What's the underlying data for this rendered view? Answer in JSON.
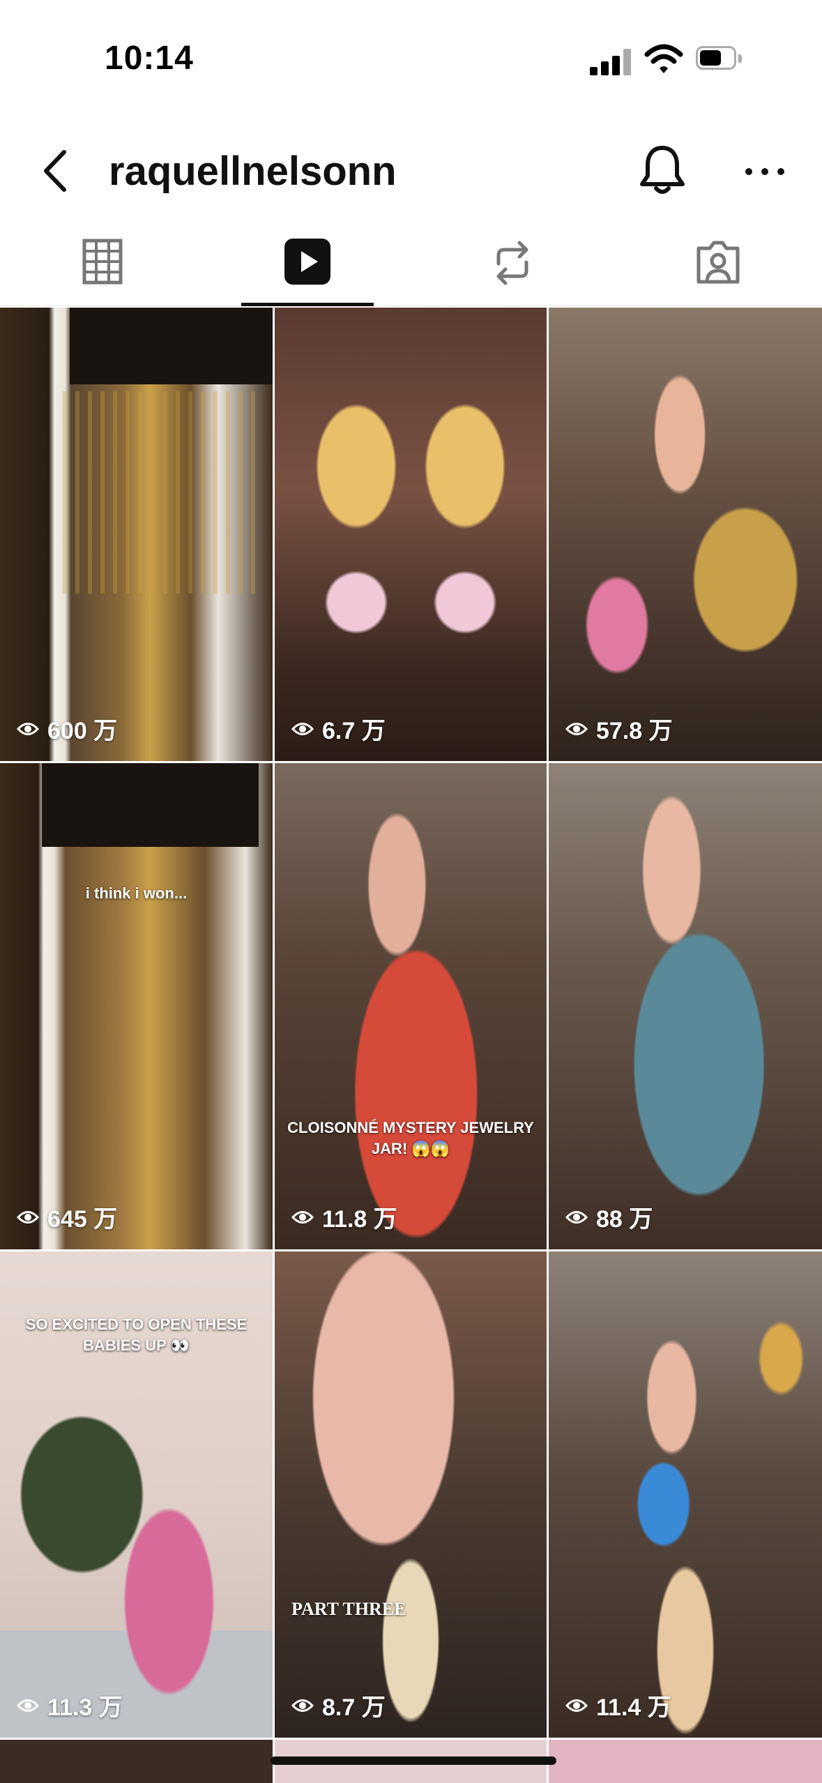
{
  "status_bar": {
    "time": "10:14"
  },
  "header": {
    "username": "raquellnelsonn"
  },
  "tabs": [
    {
      "icon": "grid-icon"
    },
    {
      "icon": "play-icon",
      "active": true
    },
    {
      "icon": "repost-icon"
    },
    {
      "icon": "tagged-icon"
    }
  ],
  "videos": [
    {
      "views": "600 万",
      "caption": ""
    },
    {
      "views": "6.7 万",
      "caption": ""
    },
    {
      "views": "57.8 万",
      "caption": ""
    },
    {
      "views": "645 万",
      "caption": "i think i won..."
    },
    {
      "views": "11.8 万",
      "caption": "CLOISONNÉ MYSTERY JEWELRY JAR! 😱😱"
    },
    {
      "views": "88 万",
      "caption": ""
    },
    {
      "views": "11.3 万",
      "caption": "SO EXCITED TO OPEN THESE BABIES UP 👀"
    },
    {
      "views": "8.7 万",
      "caption": "PART THREE"
    },
    {
      "views": "11.4 万",
      "caption": ""
    }
  ],
  "colors": {
    "accent": "#111111",
    "background": "#ffffff"
  }
}
